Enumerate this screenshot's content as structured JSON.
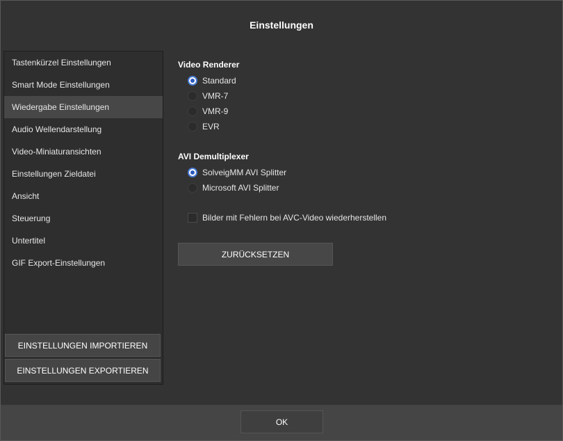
{
  "dialog": {
    "title": "Einstellungen"
  },
  "sidebar": {
    "active_index": 2,
    "items": [
      {
        "label": "Tastenkürzel Einstellungen"
      },
      {
        "label": "Smart Mode Einstellungen"
      },
      {
        "label": "Wiedergabe Einstellungen"
      },
      {
        "label": "Audio Wellendarstellung"
      },
      {
        "label": "Video-Miniaturansichten"
      },
      {
        "label": "Einstellungen Zieldatei"
      },
      {
        "label": "Ansicht"
      },
      {
        "label": "Steuerung"
      },
      {
        "label": "Untertitel"
      },
      {
        "label": "GIF Export-Einstellungen"
      }
    ],
    "import_label": "EINSTELLUNGEN IMPORTIEREN",
    "export_label": "EINSTELLUNGEN EXPORTIEREN"
  },
  "video_renderer": {
    "title": "Video Renderer",
    "selected": "Standard",
    "options": [
      {
        "label": "Standard"
      },
      {
        "label": "VMR-7"
      },
      {
        "label": "VMR-9"
      },
      {
        "label": "EVR"
      }
    ]
  },
  "avi_demux": {
    "title": "AVI Demultiplexer",
    "selected": "SolveigMM AVI Splitter",
    "options": [
      {
        "label": "SolveigMM AVI Splitter"
      },
      {
        "label": "Microsoft AVI Splitter"
      }
    ]
  },
  "repair_option": {
    "label": "Bilder mit Fehlern bei AVC-Video wiederherstellen",
    "checked": false
  },
  "reset_label": "ZURÜCKSETZEN",
  "footer": {
    "ok_label": "OK"
  },
  "colors": {
    "background": "#333333",
    "sidebar_active": "#474747",
    "radio_accent": "#4a7dd6",
    "footer": "#454545"
  }
}
